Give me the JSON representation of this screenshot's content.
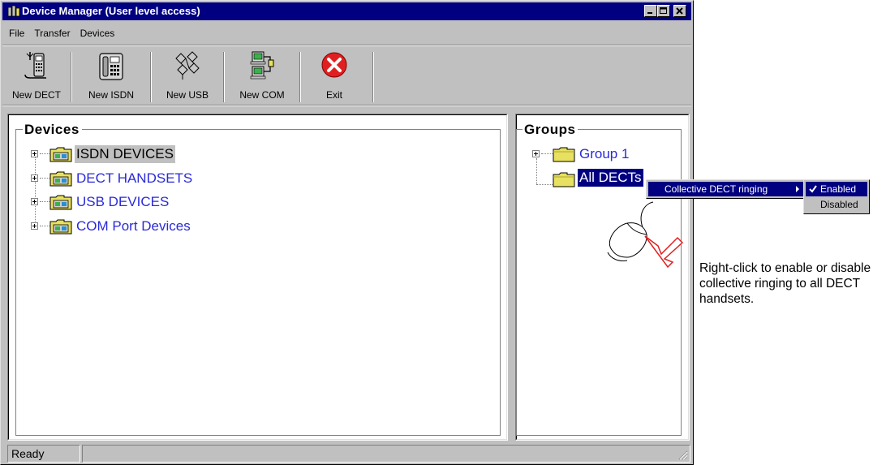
{
  "window": {
    "title": "Device Manager (User level access)"
  },
  "menubar": {
    "items": [
      "File",
      "Transfer",
      "Devices"
    ]
  },
  "toolbar": {
    "buttons": [
      {
        "label": "New DECT",
        "icon": "dect-phone-icon"
      },
      {
        "label": "New ISDN",
        "icon": "isdn-phone-icon"
      },
      {
        "label": "New USB",
        "icon": "usb-devices-icon"
      },
      {
        "label": "New COM",
        "icon": "com-port-icon"
      },
      {
        "label": "Exit",
        "icon": "exit-icon"
      }
    ]
  },
  "devices_panel": {
    "title": "Devices",
    "items": [
      {
        "label": "ISDN DEVICES",
        "selected": true
      },
      {
        "label": "DECT HANDSETS",
        "selected": false
      },
      {
        "label": "USB DEVICES",
        "selected": false
      },
      {
        "label": "COM Port Devices",
        "selected": false
      }
    ]
  },
  "groups_panel": {
    "title": "Groups",
    "items": [
      {
        "label": "Group 1"
      },
      {
        "label": "All DECTs"
      }
    ]
  },
  "context_menu": {
    "item": "Collective DECT ringing"
  },
  "submenu": {
    "items": [
      {
        "label": "Enabled",
        "checked": true
      },
      {
        "label": "Disabled",
        "checked": false
      }
    ]
  },
  "statusbar": {
    "text": "Ready"
  },
  "annotation": {
    "text": "Right-click to enable or disable collective ringing to all DECT handsets."
  },
  "colors": {
    "titlebar": "#000080",
    "window_face": "#c0c0c0",
    "tree_text": "#2a2ad8",
    "folder": "#e8e060",
    "exit_red": "#e02020"
  }
}
